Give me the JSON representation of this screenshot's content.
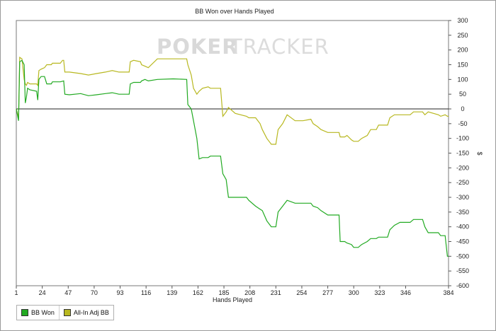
{
  "watermark": {
    "part1": "POKER",
    "part2": "TRACKER"
  },
  "chart_data": {
    "type": "line",
    "title": "BB Won over Hands Played",
    "xlabel": "Hands Played",
    "ylabel": "$",
    "xlim": [
      1,
      384
    ],
    "ylim": [
      -600,
      300
    ],
    "x_ticks": [
      1,
      24,
      47,
      70,
      93,
      116,
      139,
      162,
      185,
      208,
      231,
      254,
      277,
      300,
      323,
      346,
      384
    ],
    "y_ticks": [
      300,
      250,
      200,
      150,
      100,
      50,
      0,
      -50,
      -100,
      -150,
      -200,
      -250,
      -300,
      -350,
      -400,
      -450,
      -500,
      -550,
      -600
    ],
    "zero_line": true,
    "legend_position": "bottom-left",
    "series": [
      {
        "name": "BB Won",
        "color": "#22aa22",
        "points": [
          [
            1,
            0
          ],
          [
            3,
            -40
          ],
          [
            4,
            160
          ],
          [
            6,
            165
          ],
          [
            8,
            150
          ],
          [
            9,
            20
          ],
          [
            10,
            40
          ],
          [
            11,
            70
          ],
          [
            13,
            65
          ],
          [
            19,
            60
          ],
          [
            20,
            30
          ],
          [
            21,
            100
          ],
          [
            23,
            110
          ],
          [
            26,
            110
          ],
          [
            28,
            85
          ],
          [
            32,
            85
          ],
          [
            33,
            92
          ],
          [
            40,
            92
          ],
          [
            43,
            95
          ],
          [
            44,
            50
          ],
          [
            48,
            48
          ],
          [
            58,
            52
          ],
          [
            65,
            45
          ],
          [
            72,
            48
          ],
          [
            80,
            52
          ],
          [
            86,
            55
          ],
          [
            92,
            50
          ],
          [
            101,
            50
          ],
          [
            102,
            85
          ],
          [
            105,
            90
          ],
          [
            111,
            90
          ],
          [
            112,
            95
          ],
          [
            115,
            100
          ],
          [
            118,
            95
          ],
          [
            126,
            100
          ],
          [
            140,
            102
          ],
          [
            152,
            100
          ],
          [
            153,
            15
          ],
          [
            156,
            0
          ],
          [
            158,
            -40
          ],
          [
            161,
            -100
          ],
          [
            163,
            -170
          ],
          [
            166,
            -165
          ],
          [
            171,
            -165
          ],
          [
            173,
            -160
          ],
          [
            182,
            -160
          ],
          [
            184,
            -220
          ],
          [
            187,
            -240
          ],
          [
            189,
            -300
          ],
          [
            195,
            -300
          ],
          [
            205,
            -300
          ],
          [
            207,
            -310
          ],
          [
            213,
            -330
          ],
          [
            217,
            -340
          ],
          [
            219,
            -345
          ],
          [
            223,
            -380
          ],
          [
            227,
            -400
          ],
          [
            231,
            -400
          ],
          [
            233,
            -350
          ],
          [
            237,
            -330
          ],
          [
            241,
            -310
          ],
          [
            248,
            -320
          ],
          [
            255,
            -320
          ],
          [
            262,
            -320
          ],
          [
            264,
            -330
          ],
          [
            268,
            -335
          ],
          [
            271,
            -345
          ],
          [
            277,
            -360
          ],
          [
            287,
            -360
          ],
          [
            288,
            -450
          ],
          [
            292,
            -450
          ],
          [
            294,
            -455
          ],
          [
            298,
            -460
          ],
          [
            300,
            -470
          ],
          [
            304,
            -470
          ],
          [
            307,
            -460
          ],
          [
            312,
            -450
          ],
          [
            315,
            -440
          ],
          [
            320,
            -440
          ],
          [
            322,
            -435
          ],
          [
            330,
            -435
          ],
          [
            332,
            -410
          ],
          [
            336,
            -395
          ],
          [
            341,
            -385
          ],
          [
            350,
            -385
          ],
          [
            353,
            -375
          ],
          [
            361,
            -375
          ],
          [
            363,
            -400
          ],
          [
            366,
            -420
          ],
          [
            375,
            -420
          ],
          [
            377,
            -430
          ],
          [
            381,
            -430
          ],
          [
            383,
            -500
          ],
          [
            384,
            -500
          ]
        ]
      },
      {
        "name": "All-In Adj BB",
        "color": "#b8b820",
        "points": [
          [
            1,
            0
          ],
          [
            3,
            -30
          ],
          [
            4,
            175
          ],
          [
            6,
            170
          ],
          [
            8,
            100
          ],
          [
            9,
            85
          ],
          [
            10,
            80
          ],
          [
            11,
            90
          ],
          [
            13,
            85
          ],
          [
            19,
            85
          ],
          [
            20,
            80
          ],
          [
            21,
            130
          ],
          [
            23,
            135
          ],
          [
            26,
            140
          ],
          [
            28,
            150
          ],
          [
            32,
            150
          ],
          [
            33,
            155
          ],
          [
            40,
            155
          ],
          [
            42,
            165
          ],
          [
            43,
            165
          ],
          [
            44,
            125
          ],
          [
            48,
            125
          ],
          [
            58,
            120
          ],
          [
            65,
            115
          ],
          [
            72,
            120
          ],
          [
            80,
            125
          ],
          [
            86,
            130
          ],
          [
            92,
            125
          ],
          [
            101,
            125
          ],
          [
            102,
            160
          ],
          [
            105,
            165
          ],
          [
            111,
            160
          ],
          [
            112,
            150
          ],
          [
            115,
            145
          ],
          [
            118,
            140
          ],
          [
            126,
            170
          ],
          [
            140,
            170
          ],
          [
            152,
            170
          ],
          [
            153,
            150
          ],
          [
            156,
            115
          ],
          [
            158,
            70
          ],
          [
            161,
            50
          ],
          [
            163,
            60
          ],
          [
            166,
            70
          ],
          [
            171,
            75
          ],
          [
            173,
            70
          ],
          [
            182,
            70
          ],
          [
            184,
            -25
          ],
          [
            187,
            -10
          ],
          [
            189,
            5
          ],
          [
            195,
            -15
          ],
          [
            205,
            -25
          ],
          [
            207,
            -30
          ],
          [
            213,
            -30
          ],
          [
            217,
            -50
          ],
          [
            219,
            -70
          ],
          [
            223,
            -100
          ],
          [
            227,
            -120
          ],
          [
            231,
            -120
          ],
          [
            233,
            -70
          ],
          [
            237,
            -50
          ],
          [
            241,
            -20
          ],
          [
            248,
            -40
          ],
          [
            255,
            -40
          ],
          [
            262,
            -35
          ],
          [
            264,
            -50
          ],
          [
            268,
            -60
          ],
          [
            271,
            -70
          ],
          [
            277,
            -80
          ],
          [
            287,
            -80
          ],
          [
            288,
            -95
          ],
          [
            292,
            -95
          ],
          [
            294,
            -90
          ],
          [
            298,
            -105
          ],
          [
            300,
            -110
          ],
          [
            304,
            -110
          ],
          [
            307,
            -100
          ],
          [
            312,
            -90
          ],
          [
            315,
            -70
          ],
          [
            320,
            -70
          ],
          [
            322,
            -55
          ],
          [
            330,
            -55
          ],
          [
            332,
            -30
          ],
          [
            336,
            -20
          ],
          [
            341,
            -20
          ],
          [
            350,
            -20
          ],
          [
            353,
            -10
          ],
          [
            361,
            -10
          ],
          [
            363,
            -20
          ],
          [
            366,
            -10
          ],
          [
            375,
            -20
          ],
          [
            377,
            -25
          ],
          [
            381,
            -20
          ],
          [
            383,
            -25
          ],
          [
            384,
            -25
          ]
        ]
      }
    ]
  }
}
